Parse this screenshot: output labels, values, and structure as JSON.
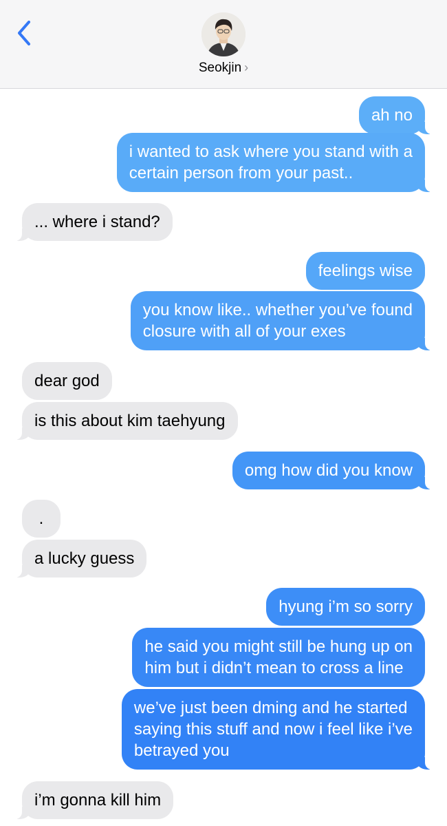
{
  "header": {
    "contact_name": "Seokjin",
    "chevron": "›",
    "back_icon": "chevron-left-icon"
  },
  "colors": {
    "outgoing_light": "#5aaef7",
    "outgoing_dark": "#2f7cf6",
    "incoming": "#e9e9eb",
    "accent": "#3478f6"
  },
  "messages": [
    {
      "from": "me",
      "text": "ah no"
    },
    {
      "from": "me",
      "lines": [
        "i wanted to ask where you stand with a",
        "certain person from your past.."
      ]
    },
    {
      "from": "them",
      "text": "... where i stand?"
    },
    {
      "from": "me",
      "text": "feelings wise"
    },
    {
      "from": "me",
      "lines": [
        "you know like.. whether you’ve found",
        "closure with all of your exes"
      ]
    },
    {
      "from": "them",
      "text": "dear god"
    },
    {
      "from": "them",
      "text": "is this about kim taehyung"
    },
    {
      "from": "me",
      "text": "omg how did you know"
    },
    {
      "from": "them",
      "text": "."
    },
    {
      "from": "them",
      "text": "a lucky guess"
    },
    {
      "from": "me",
      "text": "hyung i’m so sorry"
    },
    {
      "from": "me",
      "lines": [
        "he said you might still be hung up on",
        "him but i didn’t mean to cross a line"
      ]
    },
    {
      "from": "me",
      "lines": [
        "we’ve just been dming and he started",
        "saying this stuff and now i feel like i’ve",
        "betrayed you"
      ]
    },
    {
      "from": "them",
      "text": "i’m gonna kill him"
    }
  ]
}
